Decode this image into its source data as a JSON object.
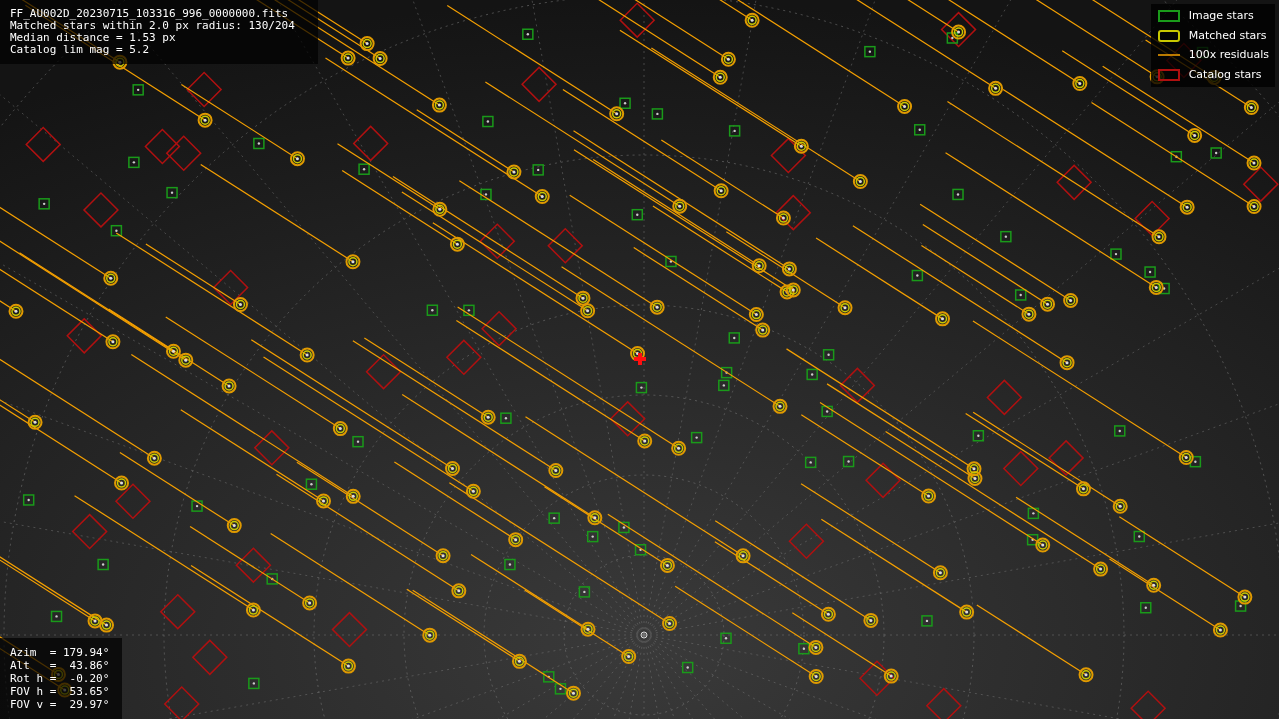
{
  "info_lines": [
    "FF_AU002D_20230715_103316_996_0000000.fits",
    "Matched stars within 2.0 px radius: 130/204",
    "Median distance = 1.53 px",
    "Catalog lim mag = 5.2"
  ],
  "legend": [
    {
      "label": "Image stars",
      "kind": "image"
    },
    {
      "label": "Matched stars",
      "kind": "matched"
    },
    {
      "label": "100x residuals",
      "kind": "residual"
    },
    {
      "label": "Catalog stars",
      "kind": "catalog"
    }
  ],
  "pointing_lines": [
    "Azim  = 179.94°",
    "Alt   =  43.86°",
    "Rot h =  -0.20°",
    "FOV h =  53.65°",
    "FOV v =  29.97°"
  ]
}
